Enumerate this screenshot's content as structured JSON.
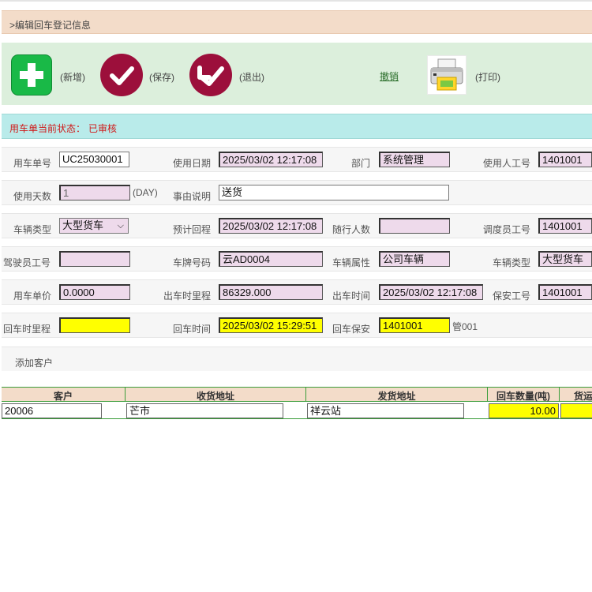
{
  "header": {
    "title": ">编辑回车登记信息"
  },
  "toolbar": {
    "add_label": "(新增)",
    "save_label": "(保存)",
    "exit_label": "(退出)",
    "revoke_label": "撤销",
    "print_label": "(打印)"
  },
  "status": {
    "label": "用车单当前状态：",
    "value": "已审核"
  },
  "form": {
    "order_no_label": "用车单号",
    "order_no": "UC25030001",
    "use_date_label": "使用日期",
    "use_date": "2025/03/02 12:17:08",
    "dept_label": "部门",
    "dept": "系统管理",
    "user_no_label": "使用人工号",
    "user_no": "1401001",
    "days_label": "使用天数",
    "days": "1",
    "days_unit": "(DAY)",
    "reason_label": "事由说明",
    "reason": "送货",
    "vehicle_type_label": "车辆类型",
    "vehicle_type": "大型货车",
    "expected_return_label": "预计回程",
    "expected_return": "2025/03/02 12:17:08",
    "companions_label": "随行人数",
    "companions": "",
    "dispatcher_label": "调度员工号",
    "dispatcher": "1401001",
    "driver_label": "驾驶员工号",
    "driver": "",
    "plate_label": "车牌号码",
    "plate": "云AD0004",
    "vehicle_attr_label": "车辆属性",
    "vehicle_attr": "公司车辆",
    "vehicle_type2_label": "车辆类型",
    "vehicle_type2": "大型货车",
    "unit_price_label": "用车单价",
    "unit_price": "0.0000",
    "out_mileage_label": "出车时里程",
    "out_mileage": "86329.000",
    "out_time_label": "出车时间",
    "out_time": "2025/03/02 12:17:08",
    "security_label": "保安工号",
    "security": "1401001",
    "return_mileage_label": "回车时里程",
    "return_mileage": "",
    "return_time_label": "回车时间",
    "return_time": "2025/03/02 15:29:51",
    "return_security_label": "回车保安",
    "return_security": "1401001",
    "return_security_name": "管001"
  },
  "add_customer": {
    "label": "添加客户"
  },
  "table": {
    "columns": [
      "客户",
      "收货地址",
      "发货地址",
      "回车数量(吨)",
      "货运"
    ],
    "rows": [
      {
        "customer": "20006",
        "receive_addr": "芒市",
        "ship_addr": "祥云站",
        "qty": "10.00",
        "freight": ""
      }
    ]
  }
}
